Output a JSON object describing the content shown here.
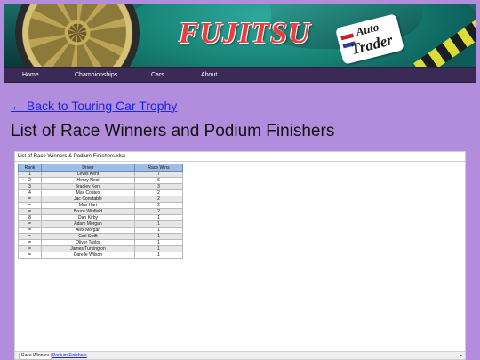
{
  "banner": {
    "sponsor_main": "FUJITSU",
    "sponsor_badge_line1": "Auto",
    "sponsor_badge_line2": "Trader"
  },
  "nav": {
    "items": [
      {
        "label": "Home"
      },
      {
        "label": "Championships"
      },
      {
        "label": "Cars"
      },
      {
        "label": "About"
      }
    ]
  },
  "back_link": "← Back to Touring Car Trophy",
  "page_title": "List of Race Winners and Podium Finishers",
  "viewer": {
    "file_title": "List of Race Winners & Podium Finishers.xlsx",
    "headers": [
      "Rank",
      "Driver",
      "Race Wins"
    ],
    "rows": [
      [
        "1",
        "Lewis Kent",
        "7"
      ],
      [
        "2",
        "Henry Neal",
        "6"
      ],
      [
        "3",
        "Bradley Kent",
        "3"
      ],
      [
        "4",
        "Max Coates",
        "2"
      ],
      [
        "=",
        "Jac Constable",
        "2"
      ],
      [
        "=",
        "Max Hart",
        "2"
      ],
      [
        "=",
        "Bruce Winfield",
        "2"
      ],
      [
        "8",
        "Dan Kirby",
        "1"
      ],
      [
        "=",
        "Adam Morgan",
        "1"
      ],
      [
        "=",
        "Alex Morgan",
        "1"
      ],
      [
        "=",
        "Carl Swift",
        "1"
      ],
      [
        "=",
        "Oliver Taylor",
        "1"
      ],
      [
        "=",
        "James Turkington",
        "1"
      ],
      [
        "=",
        "Darelle Wilson",
        "1"
      ]
    ],
    "tabs": [
      {
        "label": "Race Winners",
        "active": true
      },
      {
        "label": "Podium Finishers",
        "active": false
      }
    ]
  }
}
